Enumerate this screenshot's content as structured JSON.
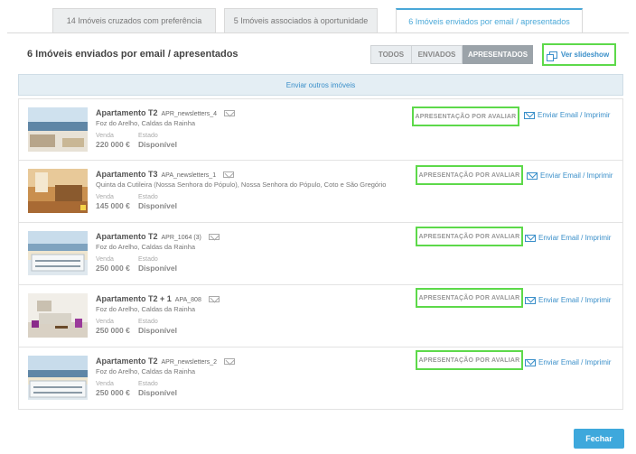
{
  "tabs": [
    {
      "label": "14 Imóveis cruzados com preferência"
    },
    {
      "label": "5 Imóveis associados à oportunidade"
    },
    {
      "label": "6 Imóveis enviados por email / apresentados"
    }
  ],
  "heading": "6 Imóveis enviados por email / apresentados",
  "filters": [
    "TODOS",
    "ENVIADOS",
    "APRESENTADOS"
  ],
  "slideshow_label": "Ver slideshow",
  "send_more_label": "Enviar outros imóveis",
  "labels": {
    "price": "Venda",
    "state": "Estado"
  },
  "items": [
    {
      "type": "Apartamento T2",
      "ref": "APR_newsletters_4",
      "location": "Foz do Arelho, Caldas da Rainha",
      "price": "220 000 €",
      "state": "Disponível",
      "status": "APRESENTAÇÃO POR AVALIAR",
      "action": "Enviar Email / Imprimir"
    },
    {
      "type": "Apartamento T3",
      "ref": "APA_newsletters_1",
      "location": "Quinta da Cutileira (Nossa Senhora do Pópulo), Nossa Senhora do Pópulo, Coto e São Gregório",
      "price": "145 000 €",
      "state": "Disponível",
      "status": "APRESENTAÇÃO POR AVALIAR",
      "action": "Enviar Email / Imprimir"
    },
    {
      "type": "Apartamento T2",
      "ref": "APR_1064 (3)",
      "location": "Foz do Arelho, Caldas da Rainha",
      "price": "250 000 €",
      "state": "Disponível",
      "status": "APRESENTAÇÃO POR AVALIAR",
      "action": "Enviar Email / Imprimir"
    },
    {
      "type": "Apartamento T2 + 1",
      "ref": "APA_808",
      "location": "Foz do Arelho, Caldas da Rainha",
      "price": "250 000 €",
      "state": "Disponível",
      "status": "APRESENTAÇÃO POR AVALIAR",
      "action": "Enviar Email / Imprimir"
    },
    {
      "type": "Apartamento T2",
      "ref": "APR_newsletters_2",
      "location": "Foz do Arelho, Caldas da Rainha",
      "price": "250 000 €",
      "state": "Disponível",
      "status": "APRESENTAÇÃO POR AVALIAR",
      "action": "Enviar Email / Imprimir"
    }
  ],
  "close_label": "Fechar",
  "colors": {
    "accent": "#3ea8dc",
    "highlight": "#5dd94a"
  }
}
